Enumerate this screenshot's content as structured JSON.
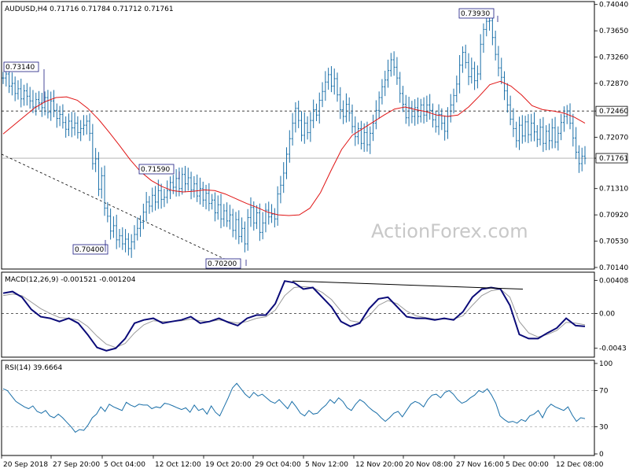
{
  "chart_data": [
    {
      "type": "candlestick",
      "panel": "price",
      "title": "AUDUSD,H4  0.71716 0.71784 0.71712 0.71761",
      "watermark": "ActionForex.com",
      "ylim": [
        0.7014,
        0.7406
      ],
      "yticks": [
        "0.74040",
        "0.73650",
        "0.73260",
        "0.72870",
        "0.72460",
        "0.72070",
        "0.71761",
        "0.71310",
        "0.70920",
        "0.70530",
        "0.70140"
      ],
      "x_labels": [
        "20 Sep 2018",
        "27 Sep 20:00",
        "5 Oct 04:00",
        "12 Oct 12:00",
        "19 Oct 20:00",
        "29 Oct 04:00",
        "5 Nov 12:00",
        "12 Nov 20:00",
        "20 Nov 08:00",
        "27 Nov 16:00",
        "5 Dec 00:00",
        "12 Dec 08:00"
      ],
      "price_labels": {
        "current": "0.71761",
        "resistance": "0.72460",
        "highs_lows": [
          "0.73140",
          "0.70400",
          "0.71590",
          "0.70200",
          "0.73930"
        ]
      },
      "close_series": [
        0.7295,
        0.7301,
        0.7283,
        0.7287,
        0.7272,
        0.7279,
        0.7264,
        0.7276,
        0.7268,
        0.7261,
        0.7252,
        0.7263,
        0.7258,
        0.7251,
        0.7266,
        0.7244,
        0.7261,
        0.7247,
        0.7235,
        0.7241,
        0.7229,
        0.7219,
        0.7231,
        0.7221,
        0.7228,
        0.7214,
        0.722,
        0.7225,
        0.7231,
        0.7213,
        0.7168,
        0.7175,
        0.713,
        0.715,
        0.7102,
        0.709,
        0.7068,
        0.7076,
        0.7055,
        0.7061,
        0.7049,
        0.7056,
        0.7042,
        0.7052,
        0.7063,
        0.7072,
        0.7081,
        0.7096,
        0.7111,
        0.7105,
        0.7121,
        0.7111,
        0.7128,
        0.7115,
        0.7118,
        0.7128,
        0.714,
        0.7133,
        0.7146,
        0.7131,
        0.7152,
        0.7138,
        0.7147,
        0.7129,
        0.7138,
        0.712,
        0.7131,
        0.7114,
        0.7124,
        0.7109,
        0.7114,
        0.7095,
        0.7107,
        0.7086,
        0.7098,
        0.7083,
        0.7092,
        0.7069,
        0.7085,
        0.706,
        0.7072,
        0.7049,
        0.7088,
        0.7103,
        0.708,
        0.7095,
        0.7066,
        0.708,
        0.7099,
        0.7089,
        0.7093,
        0.7086,
        0.7123,
        0.7136,
        0.7154,
        0.7182,
        0.7205,
        0.7228,
        0.725,
        0.7232,
        0.721,
        0.7228,
        0.7214,
        0.7232,
        0.7248,
        0.724,
        0.7262,
        0.7275,
        0.7289,
        0.73,
        0.7283,
        0.7294,
        0.727,
        0.7248,
        0.7238,
        0.7256,
        0.7243,
        0.7223,
        0.7208,
        0.722,
        0.7198,
        0.7214,
        0.7196,
        0.7213,
        0.7228,
        0.7247,
        0.7266,
        0.7282,
        0.7292,
        0.7306,
        0.7322,
        0.7311,
        0.7295,
        0.7272,
        0.7256,
        0.7236,
        0.7251,
        0.7238,
        0.7251,
        0.7238,
        0.7255,
        0.724,
        0.7255,
        0.7247,
        0.7233,
        0.7223,
        0.7241,
        0.7228,
        0.7216,
        0.7238,
        0.7255,
        0.7269,
        0.7286,
        0.7314,
        0.7333,
        0.7318,
        0.7297,
        0.7309,
        0.7291,
        0.7301,
        0.7345,
        0.7367,
        0.7379,
        0.738,
        0.7355,
        0.733,
        0.731,
        0.7296,
        0.7276,
        0.7255,
        0.7234,
        0.722,
        0.7202,
        0.7225,
        0.7209,
        0.723,
        0.7211,
        0.7228,
        0.7215,
        0.7204,
        0.7222,
        0.7198,
        0.7216,
        0.7202,
        0.7221,
        0.72,
        0.7213,
        0.7229,
        0.7238,
        0.7246,
        0.7228,
        0.7206,
        0.7185,
        0.7168,
        0.7179,
        0.7176
      ],
      "sma_series": [
        0.7212,
        0.7225,
        0.7238,
        0.7251,
        0.726,
        0.7266,
        0.7267,
        0.7262,
        0.725,
        0.7234,
        0.7215,
        0.7195,
        0.7174,
        0.7156,
        0.7143,
        0.7134,
        0.7128,
        0.7126,
        0.7127,
        0.7129,
        0.7128,
        0.7123,
        0.7116,
        0.7109,
        0.7103,
        0.7096,
        0.7092,
        0.7091,
        0.7092,
        0.7102,
        0.7125,
        0.7158,
        0.7189,
        0.721,
        0.722,
        0.723,
        0.724,
        0.7249,
        0.7252,
        0.7248,
        0.7245,
        0.724,
        0.7238,
        0.724,
        0.7252,
        0.7268,
        0.7285,
        0.729,
        0.7283,
        0.727,
        0.7254,
        0.7248,
        0.7246,
        0.7243,
        0.7237,
        0.7228
      ],
      "resistance_level": 0.7246,
      "current_price": 0.71761,
      "grid": "dashed-levels",
      "color_sma": "#e01414",
      "color_price": "#1a6fa8"
    },
    {
      "type": "line",
      "panel": "macd",
      "title": "MACD(12,26,9) -0.001521 -0.001204",
      "ylim": [
        -0.0052,
        0.0048
      ],
      "yticks": [
        "0.004085",
        "0.00",
        "-0.0043"
      ],
      "series": [
        {
          "name": "MACD",
          "values": [
            0.0025,
            0.0027,
            0.002,
            0.0005,
            -0.0004,
            -0.0006,
            -0.001,
            -0.0006,
            -0.0012,
            -0.0026,
            -0.0042,
            -0.0046,
            -0.0043,
            -0.0031,
            -0.0012,
            -0.0008,
            -0.0006,
            -0.0012,
            -0.001,
            -0.0008,
            -0.0004,
            -0.0012,
            -0.001,
            -0.0006,
            -0.0011,
            -0.0015,
            -0.0006,
            -0.0002,
            -0.0002,
            0.0012,
            0.004,
            0.0038,
            0.003,
            0.0032,
            0.002,
            0.0008,
            -0.001,
            -0.0016,
            -0.0012,
            0.0006,
            0.0018,
            0.002,
            0.0008,
            -0.0004,
            -0.0006,
            -0.0006,
            -0.0008,
            -0.0006,
            -0.0008,
            0.0002,
            0.002,
            0.003,
            0.0032,
            0.003,
            0.001,
            -0.0026,
            -0.0031,
            -0.0031,
            -0.0024,
            -0.0018,
            -0.0006,
            -0.0015,
            -0.0016
          ]
        },
        {
          "name": "Signal",
          "values": [
            0.0022,
            0.0024,
            0.0022,
            0.0014,
            0.0006,
            0.0,
            -0.0005,
            -0.0006,
            -0.0008,
            -0.0016,
            -0.0028,
            -0.0038,
            -0.0042,
            -0.0037,
            -0.0024,
            -0.0014,
            -0.0009,
            -0.001,
            -0.001,
            -0.0009,
            -0.0007,
            -0.0009,
            -0.001,
            -0.0008,
            -0.001,
            -0.0012,
            -0.001,
            -0.0006,
            -0.0004,
            0.0004,
            0.0022,
            0.0032,
            0.0033,
            0.0032,
            0.0026,
            0.0017,
            0.0003,
            -0.0009,
            -0.0011,
            -0.0003,
            0.001,
            0.0016,
            0.0012,
            0.0003,
            -0.0003,
            -0.0005,
            -0.0007,
            -0.0007,
            -0.0007,
            -0.0003,
            0.001,
            0.0022,
            0.0028,
            0.003,
            0.002,
            -0.001,
            -0.0024,
            -0.0029,
            -0.0026,
            -0.0021,
            -0.0011,
            -0.0012,
            -0.0014
          ]
        }
      ],
      "color_macd": "#0a0a78",
      "color_signal": "#9a9a9a"
    },
    {
      "type": "line",
      "panel": "rsi",
      "title": "RSI(14) 39.6664",
      "ylim": [
        0,
        100
      ],
      "yticks": [
        "100",
        "70",
        "30",
        "0"
      ],
      "levels": [
        70,
        30
      ],
      "series": [
        {
          "name": "RSI",
          "values": [
            72,
            70,
            64,
            58,
            55,
            52,
            50,
            53,
            47,
            45,
            48,
            42,
            40,
            44,
            40,
            35,
            30,
            24,
            27,
            26,
            32,
            40,
            44,
            52,
            47,
            55,
            52,
            50,
            48,
            57,
            54,
            52,
            55,
            54,
            54,
            50,
            52,
            51,
            56,
            55,
            53,
            51,
            49,
            51,
            46,
            54,
            48,
            50,
            44,
            53,
            46,
            42,
            52,
            62,
            73,
            78,
            72,
            66,
            62,
            68,
            64,
            66,
            62,
            58,
            56,
            60,
            55,
            50,
            58,
            52,
            45,
            42,
            48,
            44,
            45,
            50,
            54,
            60,
            56,
            62,
            58,
            51,
            48,
            55,
            60,
            57,
            52,
            48,
            45,
            40,
            36,
            40,
            45,
            47,
            41,
            48,
            55,
            58,
            56,
            52,
            60,
            65,
            66,
            62,
            68,
            70,
            66,
            60,
            56,
            58,
            62,
            65,
            70,
            68,
            72,
            65,
            56,
            42,
            38,
            35,
            36,
            34,
            38,
            36,
            42,
            44,
            48,
            40,
            50,
            55,
            52,
            50,
            48,
            52,
            43,
            36,
            40,
            39
          ]
        }
      ],
      "color": "#1a6fa8"
    }
  ]
}
